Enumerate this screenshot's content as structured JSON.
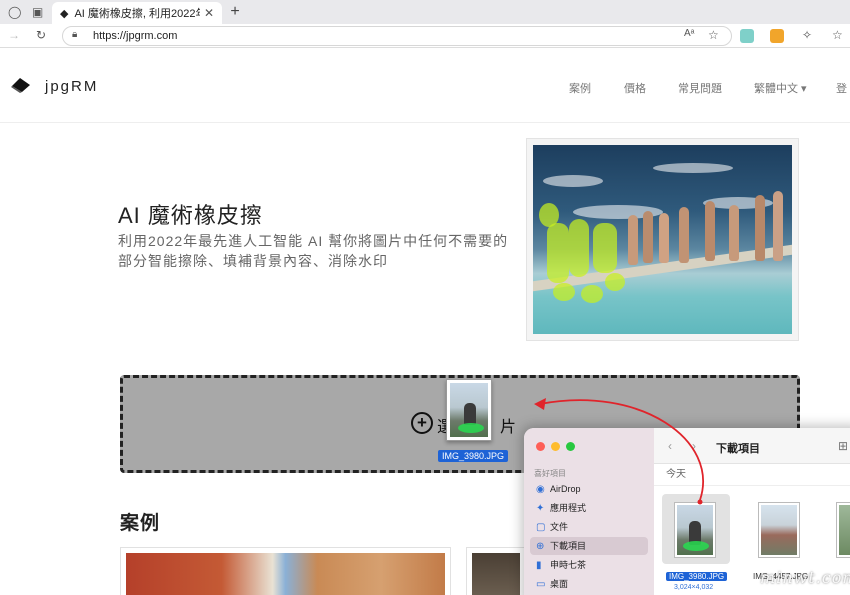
{
  "browser": {
    "tab_title": "AI 魔術橡皮擦, 利用2022年最先",
    "url": "https://jpgrm.com"
  },
  "site": {
    "brand": "jpgRM",
    "nav": [
      {
        "label": "案例"
      },
      {
        "label": "價格"
      },
      {
        "label": "常見問題"
      },
      {
        "label": "繁體中文 ▾"
      },
      {
        "label": "登"
      }
    ]
  },
  "hero": {
    "title": "AI 魔術橡皮擦",
    "subtitle": "利用2022年最先進人工智能 AI 幫你將圖片中任何不需要的部分智能擦除、填補背景內容、消除水印"
  },
  "upload": {
    "label_visible": "選",
    "label_end": "片",
    "dragged_file": "IMG_3980.JPG"
  },
  "cases": {
    "heading": "案例"
  },
  "finder": {
    "section": "喜好項目",
    "sidebar": [
      {
        "label": "AirDrop",
        "icon": "airdrop-icon",
        "glyph": "◉"
      },
      {
        "label": "應用程式",
        "icon": "apps-icon",
        "glyph": "✦"
      },
      {
        "label": "文件",
        "icon": "document-icon",
        "glyph": "▢"
      },
      {
        "label": "下載項目",
        "icon": "download-icon",
        "glyph": "⊕",
        "selected": true
      },
      {
        "label": "申時七茶",
        "icon": "file-icon",
        "glyph": "▮"
      },
      {
        "label": "桌面",
        "icon": "desktop-icon",
        "glyph": "▭"
      }
    ],
    "title": "下載項目",
    "group": "今天",
    "files": [
      {
        "name": "IMG_3980.JPG",
        "dims": "3,024×4,032",
        "selected": true
      },
      {
        "name": "IMG_4457.JPG",
        "dims": "",
        "selected": false
      }
    ]
  },
  "watermark": "minwt.com",
  "colors": {
    "accent_blue": "#1e63d6",
    "arrow_red": "#e0242b",
    "upload_bg": "#a8a8a8"
  }
}
